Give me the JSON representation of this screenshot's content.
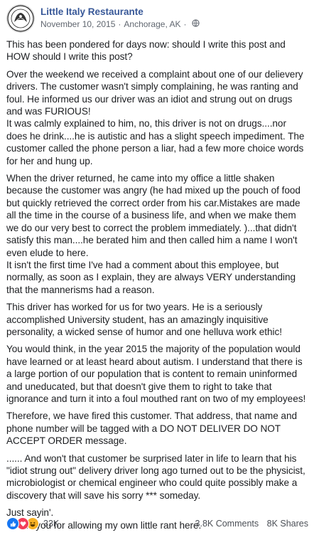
{
  "post": {
    "author": "Little Italy Restaurante",
    "date": "November 10, 2015",
    "separator": "·",
    "location": "Anchorage, AK",
    "separator2": "·",
    "audience_icon": "globe-icon",
    "paragraphs": [
      "This has been pondered for days now: should I write this post and HOW should I write this post?",
      "Over the weekend we received a complaint about one of our delievery drivers. The customer wasn't simply complaining, he was ranting and foul. He informed us our driver was an idiot and strung out on drugs and was FURIOUS!\nIt was calmly explained to him, no, this driver is not on drugs....nor does he drink....he is autistic and has a slight speech impediment. The customer called the phone person a liar, had a few more choice words for her and hung up.",
      "When the driver returned, he came into my office a little shaken because the customer was angry (he had mixed up the pouch of food but quickly retrieved the correct order from his car.Mistakes are made all the time in the course of a business life, and when we make them we do our very best to correct the problem immediately. )...that didn't satisfy this man....he berated him and then called him a name I won't even elude to here.\nIt isn't the first time I've had a comment about this employee, but normally, as soon as I explain, they are always VERY understanding that the mannerisms had a reason.",
      "This driver has worked for us for two years. He is a seriously accomplished University student, has an amazingly inquisitive personality, a wicked sense of humor and one helluva work ethic!",
      "You would think, in the year 2015 the majority of the population would have learned or at least heard about autism. I understand that there is a large portion of our population that is content to remain uninformed and uneducated, but that doesn't give them to right to take that ignorance and turn it into a foul mouthed rant on two of my employees!",
      "Therefore, we have fired this customer. That address, that name and phone number will be tagged with a DO NOT DELIVER DO NOT ACCEPT ORDER message.",
      "...... And won't that customer be surprised later in life to learn that his \"idiot strung out\" delivery driver long ago turned out to be the physicist, microbiologist or chemical engineer who could quite possibly make a discovery that will save his sorry *** someday.",
      "Just sayin'.\nThank you for allowing my own little rant here."
    ]
  },
  "footer": {
    "reaction_icons": [
      "like-icon",
      "love-icon",
      "haha-icon"
    ],
    "reaction_count": "33K",
    "comments": "3.8K Comments",
    "shares": "8K Shares"
  },
  "colors": {
    "link": "#385898",
    "meta": "#616770",
    "like": "#1877f2",
    "love": "#f33e58",
    "haha": "#f7b125"
  }
}
